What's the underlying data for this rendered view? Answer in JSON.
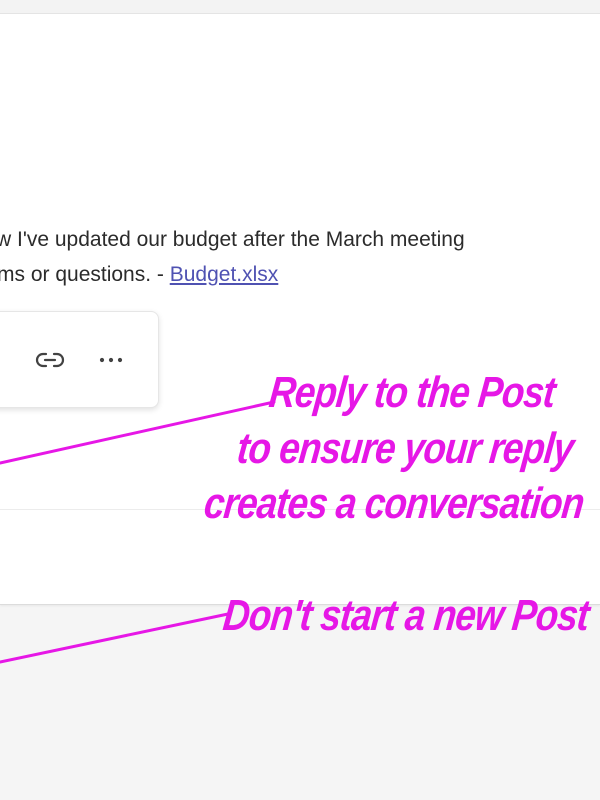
{
  "post": {
    "line1": "w I've updated our budget after the March meeting",
    "line2_prefix": "ms or questions. - ",
    "attachment_link": "Budget.xlsx"
  },
  "action_bar": {
    "icons": [
      "link-icon",
      "more-icon"
    ]
  },
  "annotations": {
    "reply_line1": "Reply to the Post",
    "reply_line2": "to ensure your reply",
    "reply_line3": "creates a conversation",
    "new_post_note": "Don't start a new Post"
  },
  "colors": {
    "annotation": "#e617e6",
    "link": "#4f52b2",
    "text": "#2b2b2b",
    "background": "#f5f5f5",
    "card": "#ffffff"
  }
}
